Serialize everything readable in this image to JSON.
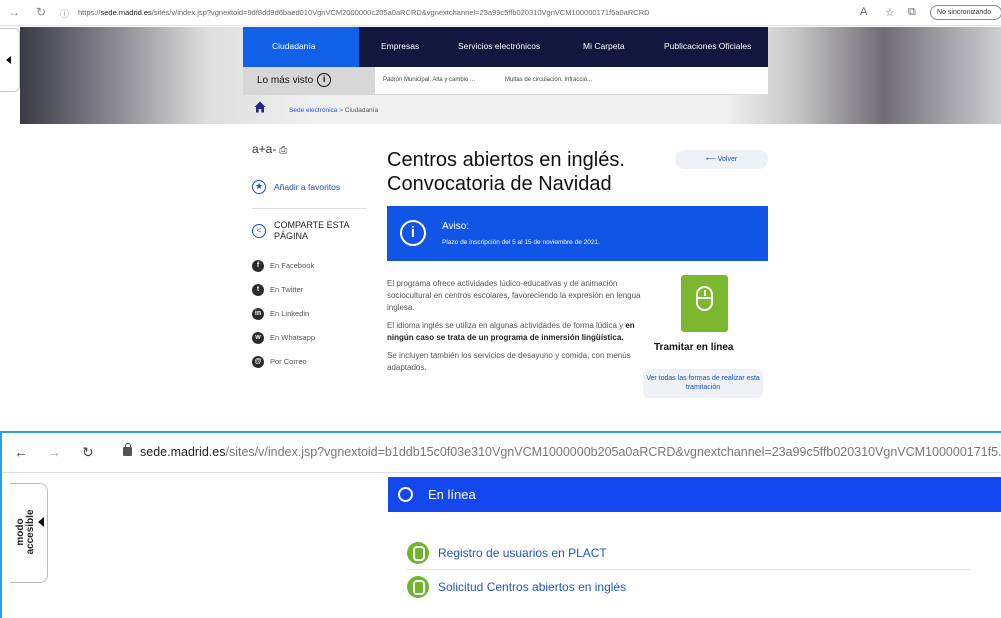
{
  "shot1": {
    "url_prefix": "https://",
    "url_domain": "sede.madrid.es",
    "url_rest": "/sites/v/index.jsp?vgnextoid=9df8dd9d6baed010VgnVCM2000000c205a0aRCRD&vgnextchannel=23a99c5ffb020310VgnVCM100000171f5a0aRCRD",
    "sync_label": "No sincronizando",
    "menu": {
      "items": [
        "Ciudadanía",
        "Empresas",
        "Servicios electrónicos",
        "Mi Carpeta",
        "Publicaciones Oficiales"
      ],
      "active_color": "#1060e8",
      "bar_color": "#12173d"
    },
    "mas_visto": {
      "label": "Lo más visto",
      "links": [
        "Padrón Municipal. Alta y cambio ...",
        "Multas de circulación. Infracció..."
      ]
    },
    "breadcrumb": {
      "parent": "Sede electrónica",
      "sep": ">",
      "current": "Ciudadanía"
    },
    "sidebar": {
      "text_size": "a+a-",
      "favorites": "Añadir a favoritos",
      "share": "COMPARTE ESTA PÁGINA",
      "social": [
        {
          "label": "En Facebook",
          "glyph": "f"
        },
        {
          "label": "En Twitter",
          "glyph": "t"
        },
        {
          "label": "En Linkedin",
          "glyph": "in"
        },
        {
          "label": "En Whatsapp",
          "glyph": "w"
        },
        {
          "label": "Por Correo",
          "glyph": "@"
        }
      ]
    },
    "title": "Centros abiertos en inglés. Convocatoria de Navidad",
    "back": "Volver",
    "notice": {
      "heading": "Aviso:",
      "text": "Plazo de inscripción del 5 al 15 de noviembre de 2021.",
      "color": "#1155e6"
    },
    "body": {
      "p1": "El programa ofrece actividades lúdico-educativas y de animación sociocultural en centros escolares, favoreciendo la expresión en lengua inglesa.",
      "p2_a": "El idioma inglés se utiliza en algunas actividades de forma lúdica y ",
      "p2_strong": "en ningún caso se trata de un programa de inmersión lingüística.",
      "p3": "Se incluyen también los servicios de desayuno y comida, con menús adaptados."
    },
    "tramitar": {
      "label": "Tramitar en línea",
      "more": "Ver todas las formas de realizar esta tramitación",
      "color": "#7bb830"
    }
  },
  "shot2": {
    "url_domain": "sede.madrid.es",
    "url_rest": "/sites/v/index.jsp?vgnextoid=b1ddb15c0f03e310VgnVCM1000000b205a0aRCRD&vgnextchannel=23a99c5ffb020310VgnVCM100000171f5...",
    "accessible_tab": "modo accesible",
    "online": {
      "heading": "En línea",
      "color": "#1348ee",
      "links": [
        "Registro de usuarios en PLACT",
        "Solicitud Centros abiertos en inglés"
      ]
    }
  }
}
